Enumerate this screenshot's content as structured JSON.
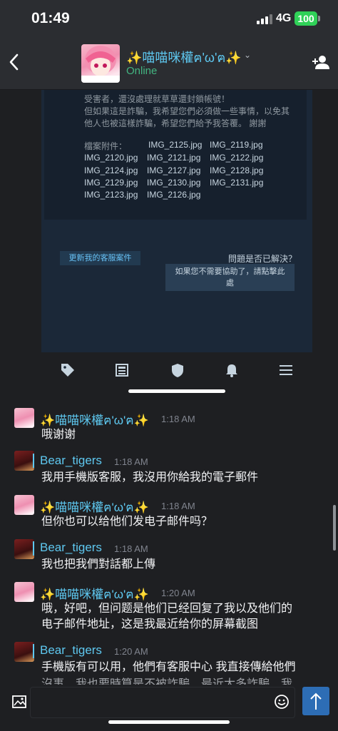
{
  "status_bar": {
    "time": "01:49",
    "network": "4G",
    "battery": "100"
  },
  "header": {
    "name": "✨喵喵咪權ฅ'ω'ฅ✨",
    "status": "Online"
  },
  "screenshot": {
    "body_lines": [
      "受害者，還沒處理就草草還封鎖帳號！",
      "但如果這是詐騙，我希望您們必須做一些事情，以免其",
      "他人也被這樣詐騙，希望您們給予我答覆。 謝謝"
    ],
    "files_label": "檔案附件：",
    "files": [
      "IMG_2125.jpg",
      "IMG_2119.jpg",
      "IMG_2120.jpg",
      "IMG_2121.jpg",
      "IMG_2122.jpg",
      "IMG_2124.jpg",
      "IMG_2127.jpg",
      "IMG_2128.jpg",
      "IMG_2129.jpg",
      "IMG_2130.jpg",
      "IMG_2131.jpg",
      "IMG_2123.jpg",
      "IMG_2126.jpg"
    ],
    "update_button": "更新我的客服案件",
    "solved_question": "問題是否已解決？",
    "help_button_line1": "如果您不需要協助了，請點擊此",
    "help_button_line2": "處"
  },
  "tabs": [
    "tag-icon",
    "news-icon",
    "shield-icon",
    "bell-icon",
    "menu-icon"
  ],
  "messages": [
    {
      "author": "✨喵喵咪權ฅ'ω'ฅ✨",
      "time": "1:18 AM",
      "lines": [
        "哦谢谢"
      ],
      "avatar": "cat"
    },
    {
      "author": "Bear_tigers",
      "time": "1:18 AM",
      "lines": [
        "我用手機版客服，我沒用你給我的電子郵件"
      ],
      "avatar": "bear"
    },
    {
      "author": "✨喵喵咪權ฅ'ω'ฅ✨",
      "time": "1:18 AM",
      "lines": [
        "但你也可以给他们发电子邮件吗？"
      ],
      "avatar": "cat"
    },
    {
      "author": "Bear_tigers",
      "time": "1:18 AM",
      "lines": [
        "我也把我們對話都上傳"
      ],
      "avatar": "bear"
    },
    {
      "author": "✨喵喵咪權ฅ'ω'ฅ✨",
      "time": "1:20 AM",
      "lines": [
        "哦，好吧，但问题是他们已经回复了我以及他们的",
        "电子邮件地址，这是我最近给你的屏幕截图"
      ],
      "avatar": "cat"
    },
    {
      "author": "Bear_tigers",
      "time": "1:20 AM",
      "lines": [
        "手機版有可以用，他們有客服中心 我直接傳給他們",
        "沒事，我也要時算是不被詐騙，最近太多詐騙，我"
      ],
      "avatar": "bear"
    }
  ],
  "composer": {
    "placeholder": "",
    "value": ""
  },
  "colors": {
    "accent": "#5ec8f0",
    "online": "#43b581",
    "send": "#2d6db5",
    "background": "#1e1f22"
  }
}
